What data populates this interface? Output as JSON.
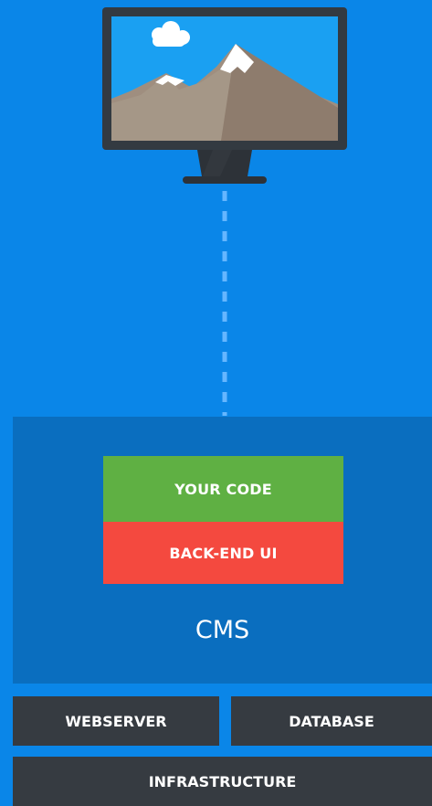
{
  "diagram": {
    "monitor": {
      "icon": "monitor-mountain-icon"
    },
    "stack": {
      "your_code_label": "YOUR CODE",
      "backend_ui_label": "BACK-END UI",
      "cms_label": "CMS",
      "webserver_label": "WEBSERVER",
      "database_label": "DATABASE",
      "infrastructure_label": "INFRASTRUCTURE"
    },
    "colors": {
      "background": "#0a86e8",
      "cms_panel": "#0a6ebf",
      "your_code": "#5fb043",
      "backend_ui": "#f4493f",
      "infrastructure": "#363b41"
    }
  }
}
